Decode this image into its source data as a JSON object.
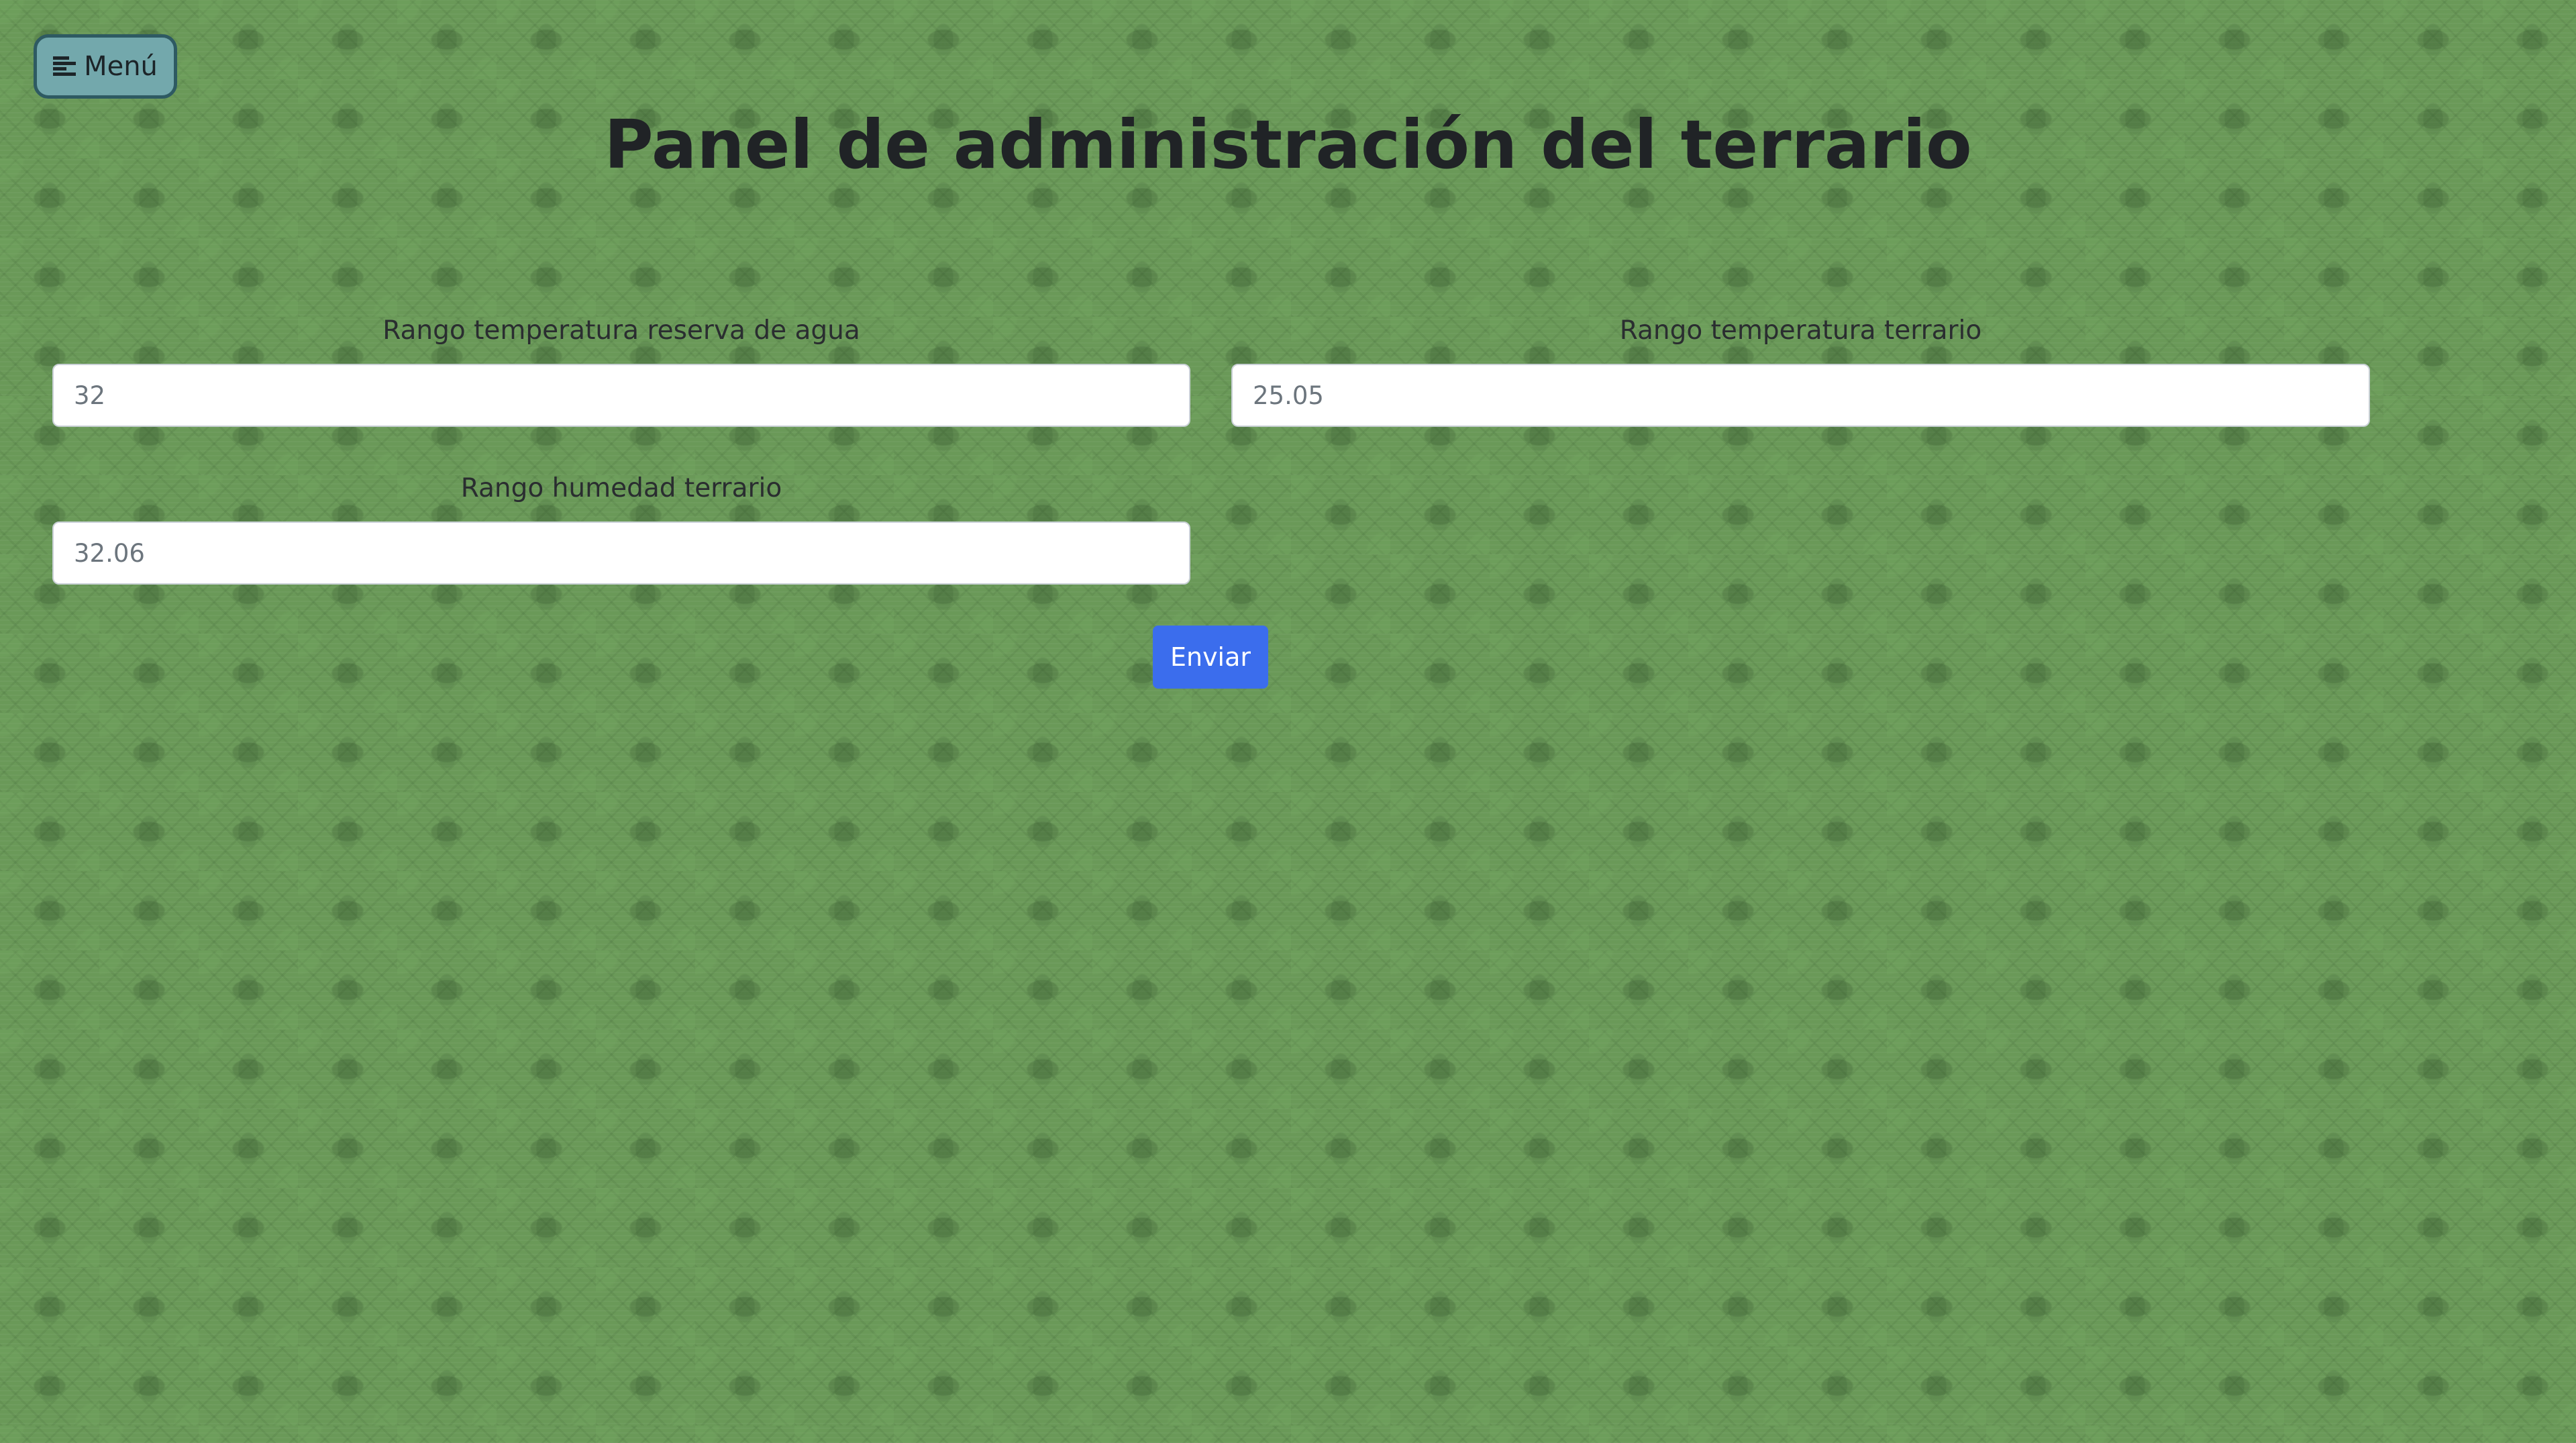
{
  "menu": {
    "label": "Menú",
    "icon": "menu-lines-icon"
  },
  "page": {
    "title": "Panel de administración del terrario"
  },
  "form": {
    "fields": [
      {
        "label": "Rango temperatura reserva de agua",
        "placeholder": "32"
      },
      {
        "label": "Rango temperatura terrario",
        "placeholder": "25.05"
      },
      {
        "label": "Rango humedad terrario",
        "placeholder": "32.06"
      }
    ],
    "submit_label": "Enviar"
  },
  "colors": {
    "background": "#6a9958",
    "menu_button": "#73a8ac",
    "menu_border": "#2e5a62",
    "submit_button": "#3b6ded"
  }
}
